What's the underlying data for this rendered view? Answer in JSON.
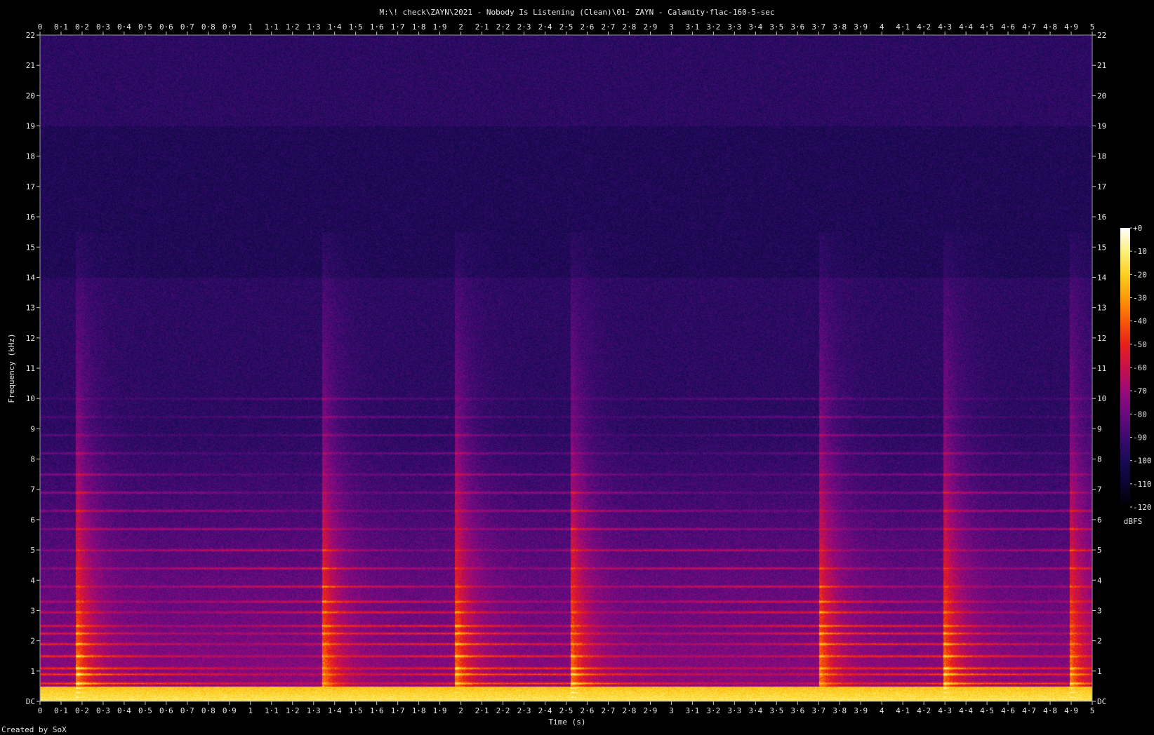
{
  "chart_data": {
    "type": "heatmap",
    "title": "M:\\! check\\ZAYN\\2021 - Nobody Is Listening (Clean)\\01· ZAYN - Calamity·flac-160-5-sec",
    "xlabel": "Time (s)",
    "ylabel": "Frequency (kHz)",
    "xlim": [
      0,
      5
    ],
    "ylim": [
      0,
      22
    ],
    "x_ticks": [
      "0",
      "0·1",
      "0·2",
      "0·3",
      "0·4",
      "0·5",
      "0·6",
      "0·7",
      "0·8",
      "0·9",
      "1",
      "1·1",
      "1·2",
      "1·3",
      "1·4",
      "1·5",
      "1·6",
      "1·7",
      "1·8",
      "1·9",
      "2",
      "2·1",
      "2·2",
      "2·3",
      "2·4",
      "2·5",
      "2·6",
      "2·7",
      "2·8",
      "2·9",
      "3",
      "3·1",
      "3·2",
      "3·3",
      "3·4",
      "3·5",
      "3·6",
      "3·7",
      "3·8",
      "3·9",
      "4",
      "4·1",
      "4·2",
      "4·3",
      "4·4",
      "4·5",
      "4·6",
      "4·7",
      "4·8",
      "4·9",
      "5"
    ],
    "y_ticks": [
      "DC",
      "1",
      "2",
      "3",
      "4",
      "5",
      "6",
      "7",
      "8",
      "9",
      "10",
      "11",
      "12",
      "13",
      "14",
      "15",
      "16",
      "17",
      "18",
      "19",
      "20",
      "21",
      "22"
    ],
    "colorbar": {
      "label": "dBFS",
      "range": [
        -120,
        0
      ],
      "ticks": [
        "+0",
        "-10",
        "-20",
        "-30",
        "-40",
        "-50",
        "-60",
        "-70",
        "-80",
        "-90",
        "-100",
        "-110",
        "-120"
      ],
      "colors": [
        "#000000",
        "#0a0530",
        "#1a0a55",
        "#3d0a70",
        "#6a0a80",
        "#9a0a78",
        "#c8104a",
        "#e8201a",
        "#f85a08",
        "#fc9a08",
        "#fcd020",
        "#fcf080",
        "#ffffff"
      ]
    },
    "onsets_s": [
      0.18,
      1.35,
      1.98,
      2.53,
      3.71,
      4.3,
      4.9
    ],
    "harmonic_lines_khz": [
      0.15,
      0.3,
      0.45,
      0.6,
      0.9,
      1.1,
      1.5,
      1.9,
      2.25,
      2.5,
      2.95,
      3.3,
      3.8,
      4.4,
      5.0,
      5.7,
      6.3,
      6.9,
      7.5,
      8.2,
      8.8,
      9.4,
      10.0
    ],
    "noise_floor_dbfs": -95,
    "low_freq_energy_dbfs": -10
  },
  "footer": {
    "credit": "Created by SoX"
  }
}
